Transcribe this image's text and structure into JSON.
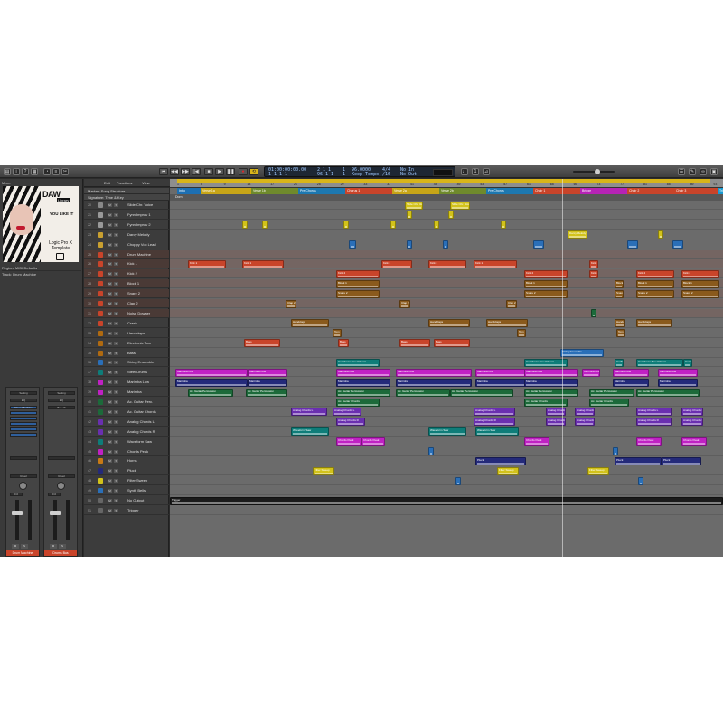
{
  "transport": {
    "position_time": "01:00:00:00.00",
    "position_bars": "1 1 1 1",
    "right_top": "2 1 1",
    "right_bottom": "96 1 1",
    "tempo": "96.0000",
    "tempo_mode": "Keep Tempo",
    "signature": "4/4",
    "division": "/16",
    "midi_in": "No In",
    "midi_out": "No Out",
    "val1": "1",
    "val2": "1"
  },
  "inspector": {
    "header": "Mixer",
    "region_label": "Region: MIDI Defaults",
    "track_label": "Track: Drum Machine",
    "artwork": {
      "brand": "DAW",
      "brand_sub": "Library",
      "tagline": "YOU LIKE IT",
      "product": "Logic Pro X Template"
    },
    "strip1": {
      "name": "Drum Machine",
      "setting": "Setting",
      "eq": "EQ",
      "midi": "Drum Machine",
      "val": "0.0",
      "val2": "-1.8",
      "read": "Read"
    },
    "strip2": {
      "name": "Drums Bus",
      "setting": "Setting",
      "eq": "EQ",
      "midi": "Bus 16",
      "val": "0.0",
      "val2": "-1.4",
      "read": "Read"
    }
  },
  "menus": {
    "edit": "Edit",
    "functions": "Functions",
    "view": "View",
    "snap": "Snap: Smart",
    "drag": "Drag: X-Fade"
  },
  "globals": {
    "marker": "Marker: Song Structure",
    "signature": "Signature: Time & Key",
    "sig_value": "Dorn"
  },
  "markers": [
    {
      "label": "Intro",
      "color": "#1d6fb2"
    },
    {
      "label": "Verse 1a",
      "color": "#c7a517"
    },
    {
      "label": "Verse 1b",
      "color": "#6f8a2c"
    },
    {
      "label": "Pre Chorus",
      "color": "#1d78b0"
    },
    {
      "label": "Chorus 1",
      "color": "#c9442a"
    },
    {
      "label": "Verse 2a",
      "color": "#c7a517"
    },
    {
      "label": "Verse 2b",
      "color": "#6f8a2c"
    },
    {
      "label": "Pre Chorus",
      "color": "#1d78b0"
    },
    {
      "label": "Choir 1",
      "color": "#c9442a"
    },
    {
      "label": "Bridge",
      "color": "#b623b5"
    },
    {
      "label": "Choir 2",
      "color": "#c9442a"
    },
    {
      "label": "Choir 3",
      "color": "#c9442a"
    },
    {
      "label": "Trig",
      "color": "#1a9ad0"
    }
  ],
  "ruler_ticks": [
    "1",
    "5",
    "9",
    "13",
    "17",
    "21",
    "25",
    "29",
    "33",
    "37",
    "41",
    "45",
    "49",
    "53",
    "57",
    "61",
    "65",
    "69",
    "73",
    "77",
    "81",
    "85",
    "89",
    "93"
  ],
  "tracks": [
    {
      "num": "20",
      "name": "Slide Chr. Voice"
    },
    {
      "num": "21",
      "name": "Fynn Improv 1"
    },
    {
      "num": "22",
      "name": "Fynn Improv 2"
    },
    {
      "num": "23",
      "name": "Darcy Melody"
    },
    {
      "num": "24",
      "name": "Choppy Vox Lead"
    },
    {
      "num": "25",
      "name": "Drum Machine"
    },
    {
      "num": "26",
      "name": "Kick 1"
    },
    {
      "num": "27",
      "name": "Kick 2"
    },
    {
      "num": "28",
      "name": "Block 1"
    },
    {
      "num": "29",
      "name": "Snare 2"
    },
    {
      "num": "30",
      "name": "Clap 2"
    },
    {
      "num": "31",
      "name": "Noise Downer"
    },
    {
      "num": "32",
      "name": "Crash"
    },
    {
      "num": "33",
      "name": "Handclaps"
    },
    {
      "num": "34",
      "name": "Electronic Tom"
    },
    {
      "num": "35",
      "name": "Bass"
    },
    {
      "num": "36",
      "name": "String Ensemble"
    },
    {
      "num": "37",
      "name": "Steel Drums"
    },
    {
      "num": "38",
      "name": "Marimba Low"
    },
    {
      "num": "39",
      "name": "Marimba"
    },
    {
      "num": "40",
      "name": "Ac. Guitar Perc."
    },
    {
      "num": "41",
      "name": "Ac. Guitar Chords"
    },
    {
      "num": "42",
      "name": "Analog Chords L"
    },
    {
      "num": "43",
      "name": "Analog Chords R"
    },
    {
      "num": "44",
      "name": "Waveform Saw"
    },
    {
      "num": "45",
      "name": "Chords Peak"
    },
    {
      "num": "46",
      "name": "Horns"
    },
    {
      "num": "47",
      "name": "Pluck"
    },
    {
      "num": "48",
      "name": "Filter Sweep"
    },
    {
      "num": "49",
      "name": "Synth Bells"
    },
    {
      "num": "50",
      "name": "No Output"
    },
    {
      "num": "51",
      "name": "Trigger"
    }
  ],
  "region_labels": {
    "kick": "Kick 1",
    "kick2": "Kick 2",
    "block": "Block 1",
    "snare": "Snare 2",
    "clap": "Clap 2",
    "hand": "Handclaps",
    "tom": "Tom",
    "bass": "Bass",
    "str": "String Ensemble",
    "steel": "Caribbean Steel Drums",
    "marl": "Marimba Low",
    "mar": "Marimba",
    "agp": "Ac. Guitar Percussion",
    "agc": "Ac. Guitar Chords",
    "acl": "Analog Chords L",
    "acr": "Analog Chords R",
    "saw": "Waveform Saw",
    "peak": "Chords Peak",
    "pluck": "Pluck",
    "sweep": "Filter Sweep",
    "trig": "Trigger",
    "vox": "Darcy Melody",
    "slide": "Slide Chr. Voice",
    "dm": "Drum Machine"
  },
  "colors": {
    "accent": "#d8b51a",
    "drum": "#c9442a",
    "orange": "#d86a10",
    "brown": "#8a5a1c",
    "teal": "#0e7d79",
    "magenta": "#c021c4",
    "purple": "#6a2fb0",
    "navy": "#242a7a",
    "green": "#1c6a3a",
    "yellow": "#d2c21a",
    "blue": "#2a6fb8",
    "record": "#e0262a"
  }
}
